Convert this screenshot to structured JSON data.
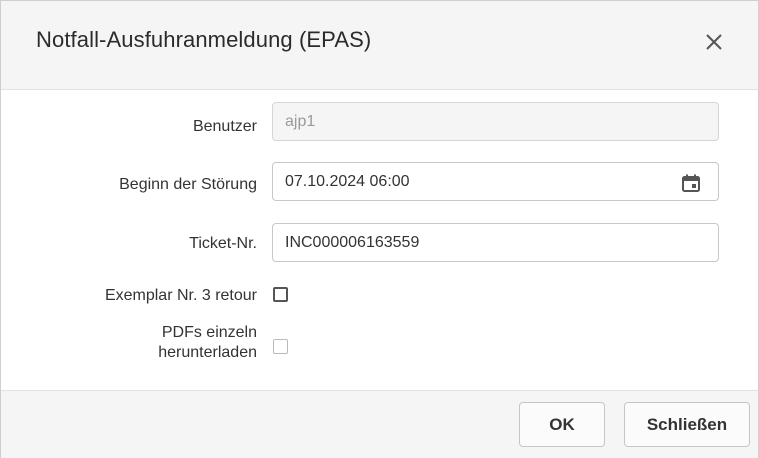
{
  "dialog": {
    "title": "Notfall-Ausfuhranmeldung (EPAS)",
    "close_icon": "close-icon"
  },
  "form": {
    "benutzer": {
      "label": "Benutzer",
      "value": "ajp1"
    },
    "beginn": {
      "label": "Beginn der Störung",
      "value": "07.10.2024 06:00",
      "icon": "calendar-icon"
    },
    "ticket": {
      "label": "Ticket-Nr.",
      "value": "INC000006163559"
    },
    "exemplar": {
      "label": "Exemplar Nr. 3 retour",
      "checked": false
    },
    "pdfs": {
      "label_line1": "PDFs einzeln",
      "label_line2": "herunterladen",
      "checked": false
    }
  },
  "footer": {
    "ok_label": "OK",
    "close_label": "Schließen"
  }
}
